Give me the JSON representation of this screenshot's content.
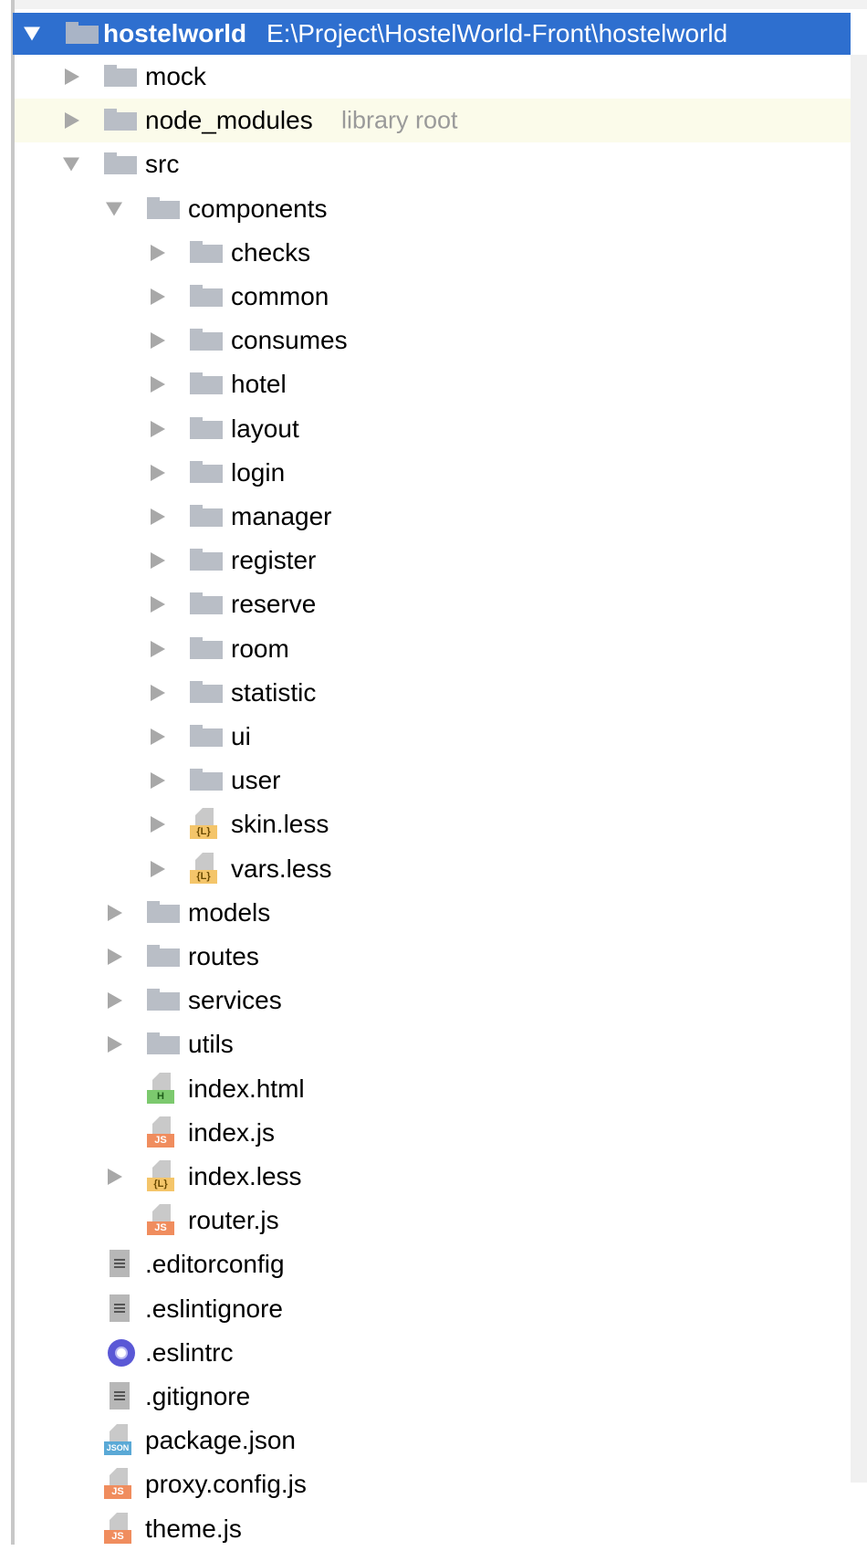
{
  "project": {
    "name": "hostelworld",
    "path": "E:\\Project\\HostelWorld-Front\\hostelworld"
  },
  "tree": [
    {
      "id": "mock",
      "label": "mock",
      "type": "folder",
      "arrow": "collapsed"
    },
    {
      "id": "node-modules",
      "label": "node_modules",
      "type": "folder",
      "arrow": "collapsed",
      "hint": "library root"
    },
    {
      "id": "src",
      "label": "src",
      "type": "folder",
      "arrow": "expanded"
    },
    {
      "id": "components",
      "label": "components",
      "type": "folder",
      "arrow": "expanded"
    },
    {
      "id": "checks",
      "label": "checks",
      "type": "folder",
      "arrow": "collapsed"
    },
    {
      "id": "common",
      "label": "common",
      "type": "folder",
      "arrow": "collapsed"
    },
    {
      "id": "consumes",
      "label": "consumes",
      "type": "folder",
      "arrow": "collapsed"
    },
    {
      "id": "hotel",
      "label": "hotel",
      "type": "folder",
      "arrow": "collapsed"
    },
    {
      "id": "layout",
      "label": "layout",
      "type": "folder",
      "arrow": "collapsed"
    },
    {
      "id": "login",
      "label": "login",
      "type": "folder",
      "arrow": "collapsed"
    },
    {
      "id": "manager",
      "label": "manager",
      "type": "folder",
      "arrow": "collapsed"
    },
    {
      "id": "register",
      "label": "register",
      "type": "folder",
      "arrow": "collapsed"
    },
    {
      "id": "reserve",
      "label": "reserve",
      "type": "folder",
      "arrow": "collapsed"
    },
    {
      "id": "room",
      "label": "room",
      "type": "folder",
      "arrow": "collapsed"
    },
    {
      "id": "statistic",
      "label": "statistic",
      "type": "folder",
      "arrow": "collapsed"
    },
    {
      "id": "ui",
      "label": "ui",
      "type": "folder",
      "arrow": "collapsed"
    },
    {
      "id": "user",
      "label": "user",
      "type": "folder",
      "arrow": "collapsed"
    },
    {
      "id": "skin-less",
      "label": "skin.less",
      "type": "less",
      "arrow": "collapsed"
    },
    {
      "id": "vars-less",
      "label": "vars.less",
      "type": "less",
      "arrow": "collapsed"
    },
    {
      "id": "models",
      "label": "models",
      "type": "folder",
      "arrow": "collapsed"
    },
    {
      "id": "routes",
      "label": "routes",
      "type": "folder",
      "arrow": "collapsed"
    },
    {
      "id": "services",
      "label": "services",
      "type": "folder",
      "arrow": "collapsed"
    },
    {
      "id": "utils",
      "label": "utils",
      "type": "folder",
      "arrow": "collapsed"
    },
    {
      "id": "index-html",
      "label": "index.html",
      "type": "html",
      "arrow": "none"
    },
    {
      "id": "index-js",
      "label": "index.js",
      "type": "js",
      "arrow": "none"
    },
    {
      "id": "index-less",
      "label": "index.less",
      "type": "less",
      "arrow": "collapsed"
    },
    {
      "id": "router-js",
      "label": "router.js",
      "type": "js",
      "arrow": "none"
    },
    {
      "id": "editorconfig",
      "label": ".editorconfig",
      "type": "text",
      "arrow": "none"
    },
    {
      "id": "eslintignore",
      "label": ".eslintignore",
      "type": "text",
      "arrow": "none"
    },
    {
      "id": "eslintrc",
      "label": ".eslintrc",
      "type": "eslint",
      "arrow": "none"
    },
    {
      "id": "gitignore",
      "label": ".gitignore",
      "type": "text",
      "arrow": "none"
    },
    {
      "id": "package-json",
      "label": "package.json",
      "type": "json",
      "arrow": "none"
    },
    {
      "id": "proxy-config-js",
      "label": "proxy.config.js",
      "type": "js",
      "arrow": "none"
    },
    {
      "id": "theme-js",
      "label": "theme.js",
      "type": "js",
      "arrow": "none"
    }
  ],
  "file_tags": {
    "js": "JS",
    "less": "{L}",
    "html": "H",
    "json": "JSON"
  },
  "colors": {
    "selection": "#2e6fcf",
    "highlight": "#fbfbea",
    "folder": "#b9bec6",
    "hint": "#9a9a9a"
  }
}
